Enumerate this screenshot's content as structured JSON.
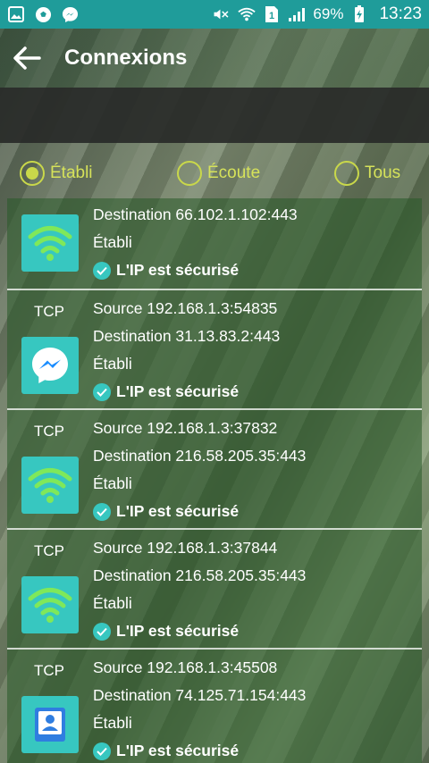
{
  "statusbar": {
    "battery_percent": "69%",
    "time": "13:23",
    "icons": [
      "gallery-icon",
      "soccer-icon",
      "messenger-icon",
      "mute-icon",
      "wifi-icon",
      "sim-icon",
      "signal-icon",
      "battery-icon"
    ]
  },
  "appbar": {
    "title": "Connexions"
  },
  "filters": {
    "options": [
      {
        "label": "Établi",
        "selected": true
      },
      {
        "label": "Écoute",
        "selected": false
      },
      {
        "label": "Tous",
        "selected": false
      }
    ]
  },
  "connections": [
    {
      "protocol": "",
      "source": "",
      "destination": "Destination 66.102.1.102:443",
      "state": "Établi",
      "security": "L'IP est sécurisé",
      "app_icon": "wifi-app-icon"
    },
    {
      "protocol": "TCP",
      "source": "Source 192.168.1.3:54835",
      "destination": "Destination 31.13.83.2:443",
      "state": "Établi",
      "security": "L'IP est sécurisé",
      "app_icon": "messenger-app-icon"
    },
    {
      "protocol": "TCP",
      "source": "Source 192.168.1.3:37832",
      "destination": "Destination 216.58.205.35:443",
      "state": "Établi",
      "security": "L'IP est sécurisé",
      "app_icon": "wifi-app-icon"
    },
    {
      "protocol": "TCP",
      "source": "Source 192.168.1.3:37844",
      "destination": "Destination 216.58.205.35:443",
      "state": "Établi",
      "security": "L'IP est sécurisé",
      "app_icon": "wifi-app-icon"
    },
    {
      "protocol": "TCP",
      "source": "Source 192.168.1.3:45508",
      "destination": "Destination 74.125.71.154:443",
      "state": "Établi",
      "security": "L'IP est sécurisé",
      "app_icon": "contacts-app-icon"
    }
  ],
  "colors": {
    "statusbar": "#1f9c9a",
    "accent": "#c9d84a",
    "teal": "#37c7c0"
  }
}
